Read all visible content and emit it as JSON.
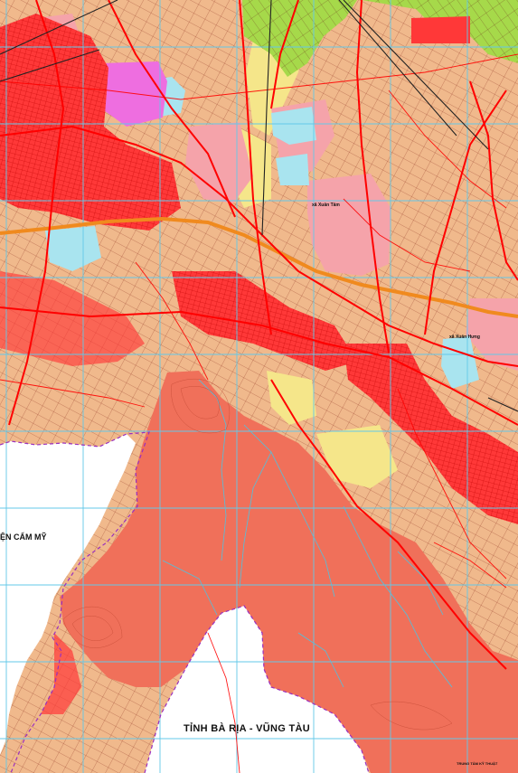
{
  "map": {
    "labels": {
      "province_south": "TỈNH BÀ RỊA - VŨNG TÀU",
      "district_west": "ỆN CẨM MỸ",
      "commune_xuan_tam": "xã Xuân Tâm",
      "commune_xuan_hung": "xã Xuân Hưng",
      "credit_title": "TRUNG TÂM KỸ THUẬT"
    },
    "colors": {
      "residential": "#ff3838",
      "forest_zone": "#f0705a",
      "pink_zone": "#f5a3aa",
      "agri_tan": "#f0b98c",
      "yellow_zone": "#f5e68a",
      "green_zone": "#a6d94a",
      "water": "#a9e4ef",
      "grid": "#63c8e8",
      "road": "#ff0000",
      "highway": "#f08a1e"
    }
  }
}
